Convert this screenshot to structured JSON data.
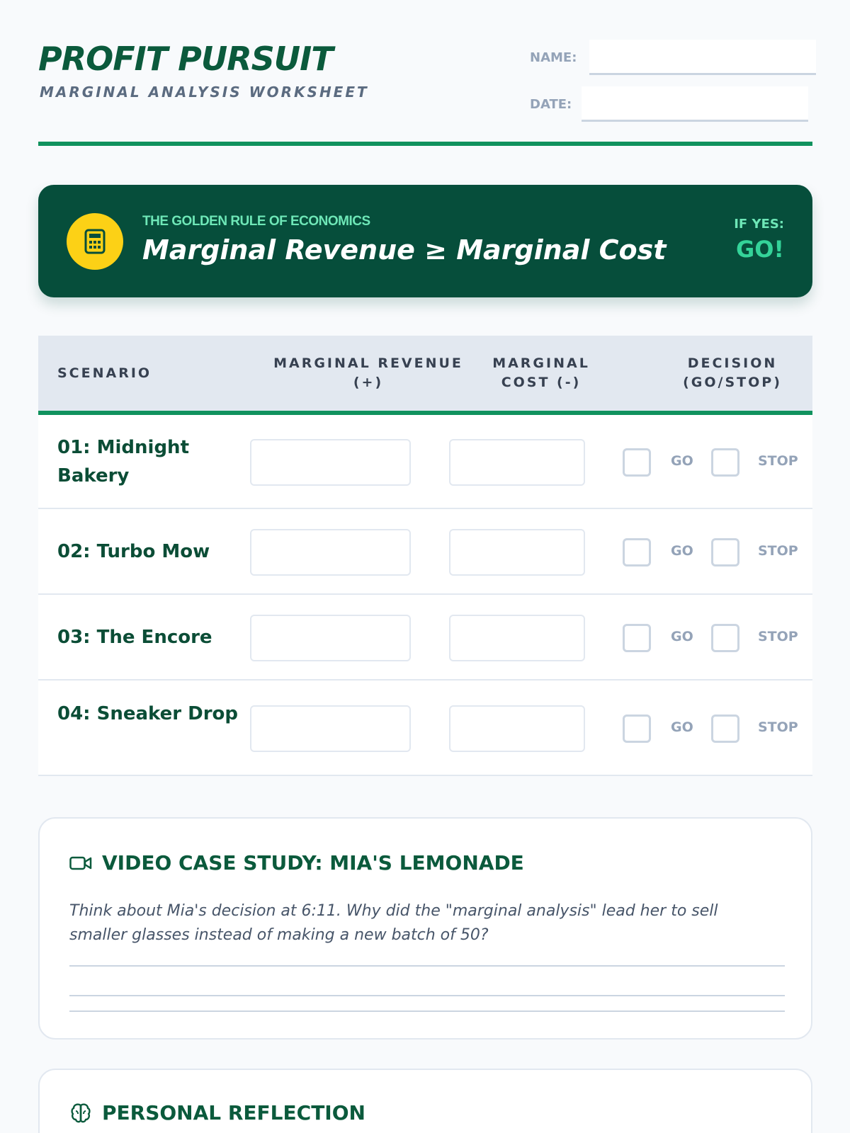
{
  "header": {
    "title": "PROFIT PURSUIT",
    "subtitle": "MARGINAL ANALYSIS WORKSHEET",
    "name_label": "NAME:",
    "date_label": "DATE:",
    "name_value": "",
    "date_value": ""
  },
  "banner": {
    "icon": "calculator-icon",
    "kicker": "THE GOLDEN RULE OF ECONOMICS",
    "rule": "Marginal Revenue ≥ Marginal Cost",
    "if_label": "IF YES:",
    "go_label": "GO!"
  },
  "table": {
    "headers": {
      "scenario": "SCENARIO",
      "mr": "MARGINAL REVENUE (+)",
      "mc": "MARGINAL COST (-)",
      "decision": "DECISION (GO/STOP)"
    },
    "go_label": "GO",
    "stop_label": "STOP",
    "rows": [
      {
        "scenario": "01: Midnight Bakery"
      },
      {
        "scenario": "02: Turbo Mow"
      },
      {
        "scenario": "03: The Encore"
      },
      {
        "scenario": "04: Sneaker Drop"
      }
    ]
  },
  "case_study": {
    "icon": "video-camera-icon",
    "title": "VIDEO CASE STUDY: MIA'S LEMONADE",
    "prompt": "Think about Mia's decision at 6:11. Why did the \"marginal analysis\" lead her to sell smaller glasses instead of making a new batch of 50?"
  },
  "reflection": {
    "icon": "brain-icon",
    "title": "PERSONAL REFLECTION"
  },
  "colors": {
    "brand_green": "#0b5a3c",
    "banner_bg": "#064e3b",
    "accent_rule": "#10925e",
    "icon_yellow": "#fcd116",
    "mint": "#6ee7b7"
  }
}
